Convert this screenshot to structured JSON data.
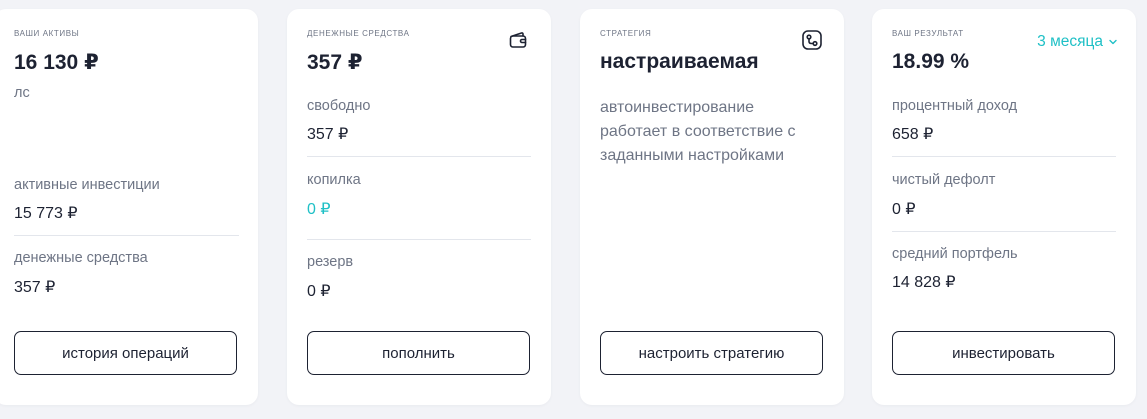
{
  "assets": {
    "caption": "ВАШИ АКТИВЫ",
    "total": "16 130 ₽",
    "account": "ЛС",
    "active_label": "активные инвестиции",
    "active_value": "15 773 ₽",
    "cash_label": "денежные средства",
    "cash_value": "357 ₽",
    "button": "история операций"
  },
  "cash": {
    "caption": "ДЕНЕЖНЫЕ СРЕДСТВА",
    "total": "357 ₽",
    "icon": "wallet-icon",
    "free_label": "свободно",
    "free_value": "357 ₽",
    "piggy_label": "копилка",
    "piggy_value": "0 ₽",
    "reserve_label": "резерв",
    "reserve_value": "0 ₽",
    "button": "пополнить"
  },
  "strategy": {
    "caption": "СТРАТЕГИЯ",
    "title": "настраиваемая",
    "icon": "route-icon",
    "description": "автоинвестирование работает в соответствие с заданными настройками",
    "button": "настроить стратегию"
  },
  "result": {
    "caption": "ВАШ РЕЗУЛЬТАТ",
    "total": "18.99 %",
    "period": "3 месяца",
    "interest_label": "процентный доход",
    "interest_value": "658 ₽",
    "default_label": "чистый дефолт",
    "default_value": "0 ₽",
    "portfolio_label": "средний портфель",
    "portfolio_value": "14 828 ₽",
    "button": "инвестировать"
  },
  "colors": {
    "background": "#f2f3f7",
    "text": "#1d2232",
    "muted": "#6e7585",
    "accent": "#1fc0c6"
  }
}
